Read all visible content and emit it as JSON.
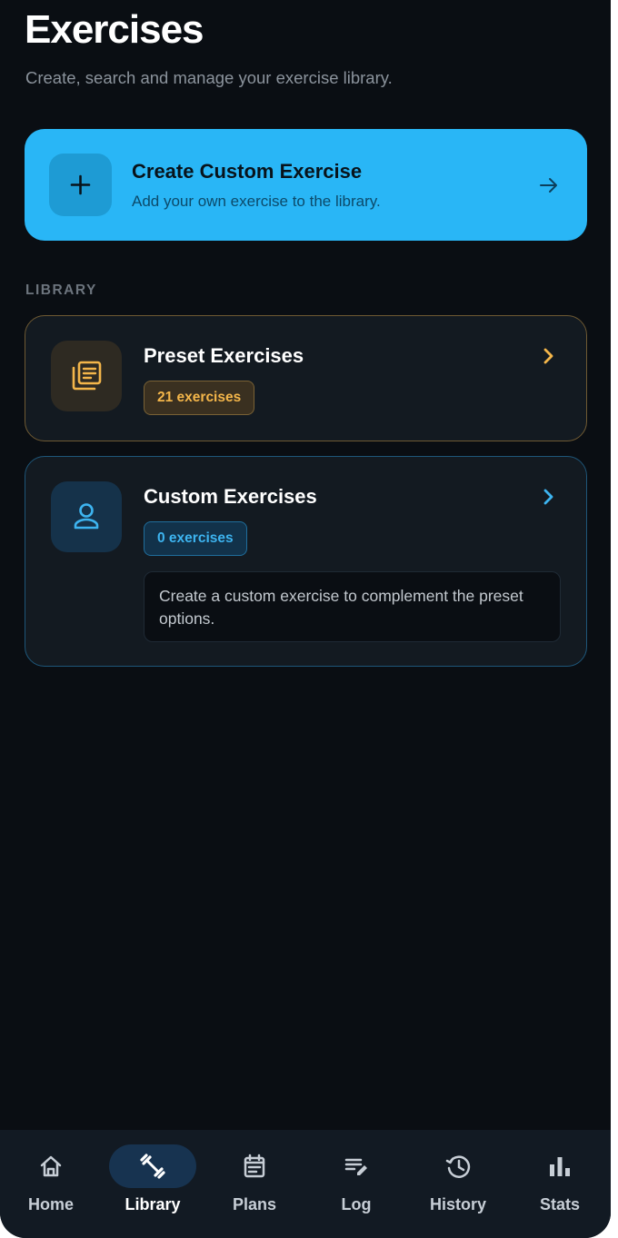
{
  "header": {
    "title": "Exercises",
    "subtitle": "Create, search and manage your exercise library."
  },
  "create_card": {
    "title": "Create Custom Exercise",
    "description": "Add your own exercise to the library.",
    "icon": "plus-icon",
    "action_icon": "arrow-right-icon",
    "color": "#29b6f6"
  },
  "library": {
    "section_label": "LIBRARY",
    "preset": {
      "title": "Preset Exercises",
      "count_label": "21 exercises",
      "icon": "library-books-icon",
      "accent": "#f4b64a"
    },
    "custom": {
      "title": "Custom Exercises",
      "count_label": "0 exercises",
      "hint": "Create a custom exercise to complement the preset options.",
      "icon": "person-icon",
      "accent": "#3db4f0"
    }
  },
  "nav": {
    "active": "Library",
    "items": [
      {
        "label": "Home",
        "icon": "home-icon"
      },
      {
        "label": "Library",
        "icon": "dumbbell-icon"
      },
      {
        "label": "Plans",
        "icon": "calendar-icon"
      },
      {
        "label": "Log",
        "icon": "edit-note-icon"
      },
      {
        "label": "History",
        "icon": "history-icon"
      },
      {
        "label": "Stats",
        "icon": "bar-chart-icon"
      }
    ]
  }
}
